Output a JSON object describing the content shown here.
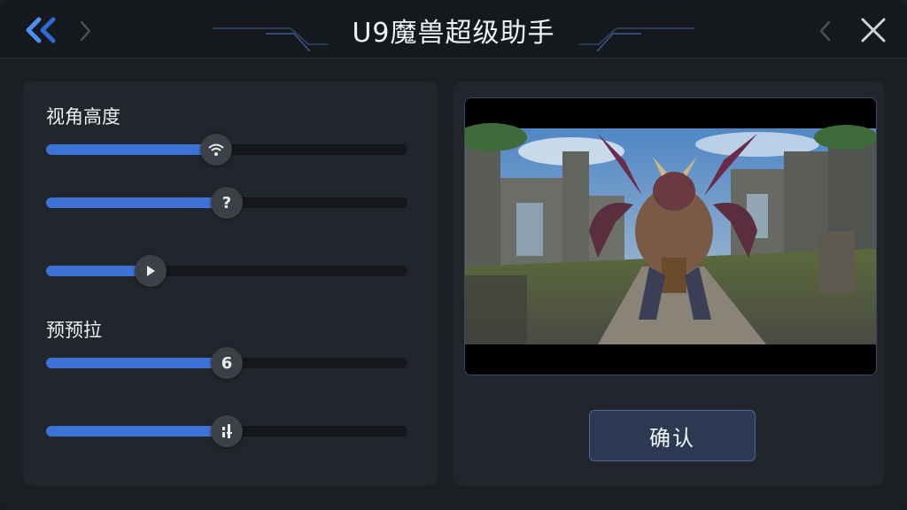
{
  "window": {
    "title": "U9魔兽超级助手"
  },
  "left_panel": {
    "label_view_height": "视角高度",
    "label_preload": "预预拉",
    "sliders": [
      {
        "value": 0.47,
        "knob_text": ""
      },
      {
        "value": 0.5,
        "knob_text": "?"
      },
      {
        "value": 0.29,
        "knob_text": ""
      },
      {
        "value": 0.5,
        "knob_text": "6"
      },
      {
        "value": 0.5,
        "knob_text": ""
      }
    ]
  },
  "right_panel": {
    "confirm_label": "确认"
  },
  "colors": {
    "accent_blue": "#3d72d6",
    "panel_bg": "#22262c",
    "button_bg": "#2b3a52"
  }
}
